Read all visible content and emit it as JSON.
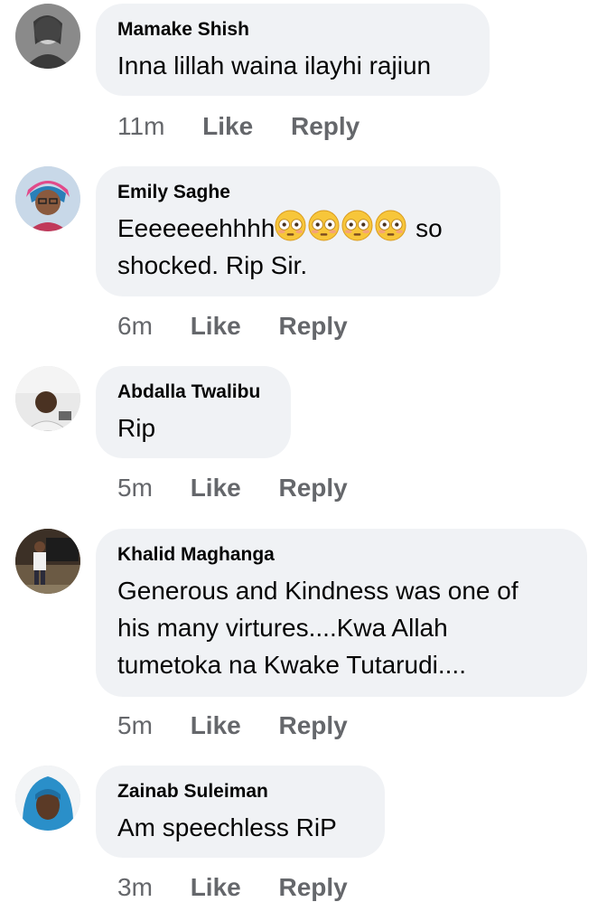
{
  "comments": [
    {
      "author": "Mamake Shish",
      "text": "Inna lillah waina ilayhi rajiun",
      "time": "11m",
      "like": "Like",
      "reply": "Reply"
    },
    {
      "author": "Emily Saghe",
      "text_before": "Eeeeeeehhhh",
      "text_after": " so",
      "text_line2": "shocked. Rip Sir.",
      "emoji_name": "flushed-face-icon",
      "time": "6m",
      "like": "Like",
      "reply": "Reply"
    },
    {
      "author": "Abdalla Twalibu",
      "text": "Rip",
      "time": "5m",
      "like": "Like",
      "reply": "Reply"
    },
    {
      "author": "Khalid Maghanga",
      "text_line1": "Generous and Kindness was one of",
      "text_line2": "his many virtures....Kwa Allah",
      "text_line3": "tumetoka na Kwake Tutarudi....",
      "time": "5m",
      "like": "Like",
      "reply": "Reply"
    },
    {
      "author": "Zainab Suleiman",
      "text": "Am speechless RiP",
      "time": "3m",
      "like": "Like",
      "reply": "Reply"
    }
  ],
  "colors": {
    "bubble": "#f0f2f5",
    "meta": "#65676b",
    "text": "#050505"
  }
}
